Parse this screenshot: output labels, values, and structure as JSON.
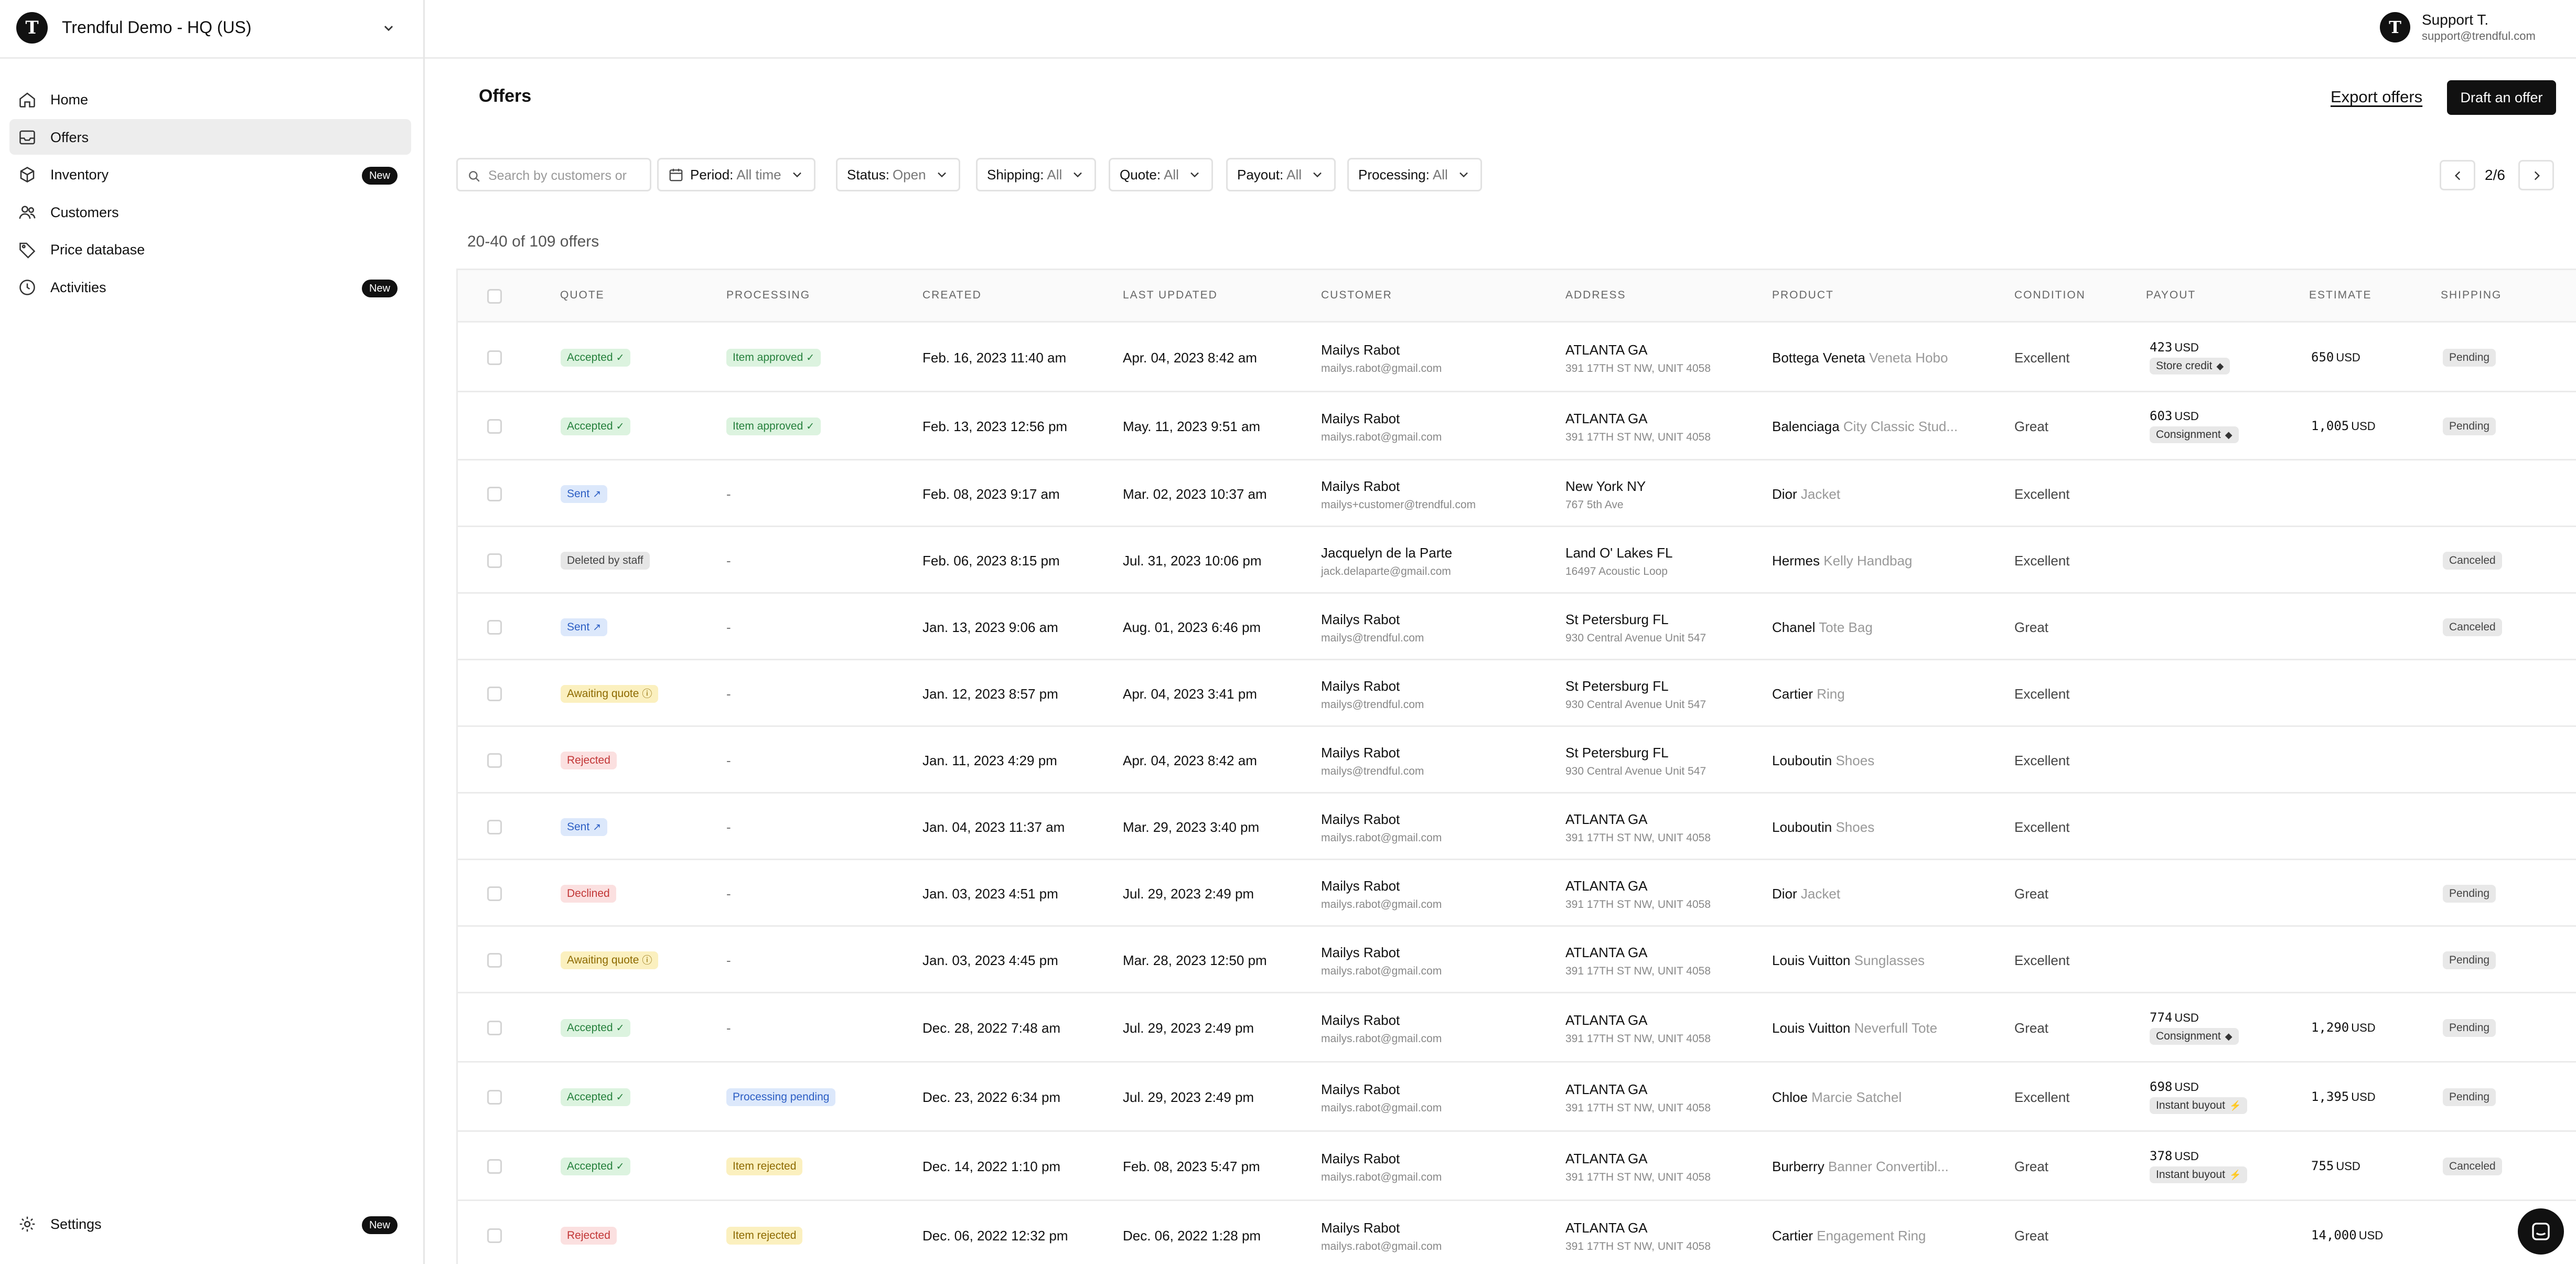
{
  "org": {
    "logo_letter": "T",
    "name": "Trendful Demo - HQ (US)"
  },
  "user": {
    "avatar_letter": "T",
    "name": "Support T.",
    "email": "support@trendful.com"
  },
  "sidebar": {
    "items": [
      {
        "label": "Home",
        "icon": "home-icon"
      },
      {
        "label": "Offers",
        "icon": "inbox-icon"
      },
      {
        "label": "Inventory",
        "icon": "box-icon",
        "badge": "New"
      },
      {
        "label": "Customers",
        "icon": "users-icon"
      },
      {
        "label": "Price database",
        "icon": "tag-icon"
      },
      {
        "label": "Activities",
        "icon": "clock-icon",
        "badge": "New"
      }
    ],
    "settings": {
      "label": "Settings",
      "icon": "gear-icon",
      "badge": "New"
    }
  },
  "page": {
    "title": "Offers",
    "export_label": "Export offers",
    "draft_label": "Draft an offer"
  },
  "search": {
    "placeholder": "Search by customers or"
  },
  "filters": {
    "period": {
      "label": "Period:",
      "value": "All time"
    },
    "status": {
      "label": "Status:",
      "value": "Open"
    },
    "shipping": {
      "label": "Shipping:",
      "value": "All"
    },
    "quote": {
      "label": "Quote:",
      "value": "All"
    },
    "payout": {
      "label": "Payout:",
      "value": "All"
    },
    "processing": {
      "label": "Processing:",
      "value": "All"
    }
  },
  "pager": {
    "text": "2/6"
  },
  "count_text": "20-40 of 109 offers",
  "table": {
    "headers": {
      "quote": "QUOTE",
      "processing": "PROCESSING",
      "created": "CREATED",
      "updated": "LAST UPDATED",
      "customer": "CUSTOMER",
      "address": "ADDRESS",
      "product": "PRODUCT",
      "condition": "CONDITION",
      "payout": "PAYOUT",
      "estimate": "ESTIMATE",
      "shipping": "SHIPPING"
    },
    "rows": [
      {
        "quote": {
          "label": "Accepted",
          "kind": "accepted"
        },
        "processing": {
          "label": "Item approved",
          "kind": "approved"
        },
        "created": "Feb. 16, 2023 11:40 am",
        "updated": "Apr. 04, 2023 8:42 am",
        "customer_name": "Mailys Rabot",
        "customer_email": "mailys.rabot@gmail.com",
        "city": "ATLANTA GA",
        "street": "391 17TH ST NW, UNIT 4058",
        "brand": "Bottega Veneta",
        "model": "Veneta Hobo",
        "condition": "Excellent",
        "payout_amount": "423",
        "payout_currency": "USD",
        "payout_type": "Store credit",
        "payout_icon": "tag-icon",
        "estimate_amount": "650",
        "estimate_currency": "USD",
        "shipping": "Pending"
      },
      {
        "quote": {
          "label": "Accepted",
          "kind": "accepted"
        },
        "processing": {
          "label": "Item approved",
          "kind": "approved"
        },
        "created": "Feb. 13, 2023 12:56 pm",
        "updated": "May. 11, 2023 9:51 am",
        "customer_name": "Mailys Rabot",
        "customer_email": "mailys.rabot@gmail.com",
        "city": "ATLANTA GA",
        "street": "391 17TH ST NW, UNIT 4058",
        "brand": "Balenciaga",
        "model": "City Classic Stud...",
        "condition": "Great",
        "payout_amount": "603",
        "payout_currency": "USD",
        "payout_type": "Consignment",
        "payout_icon": "tag-icon",
        "estimate_amount": "1,005",
        "estimate_currency": "USD",
        "shipping": "Pending"
      },
      {
        "quote": {
          "label": "Sent",
          "kind": "sent"
        },
        "processing": null,
        "created": "Feb. 08, 2023 9:17 am",
        "updated": "Mar. 02, 2023 10:37 am",
        "customer_name": "Mailys Rabot",
        "customer_email": "mailys+customer@trendful.com",
        "city": "New York NY",
        "street": "767 5th Ave",
        "brand": "Dior",
        "model": "Jacket",
        "condition": "Excellent",
        "shipping": null
      },
      {
        "quote": {
          "label": "Deleted by staff",
          "kind": "deleted"
        },
        "processing": null,
        "created": "Feb. 06, 2023 8:15 pm",
        "updated": "Jul. 31, 2023 10:06 pm",
        "customer_name": "Jacquelyn de la Parte",
        "customer_email": "jack.delaparte@gmail.com",
        "city": "Land O' Lakes FL",
        "street": "16497 Acoustic Loop",
        "brand": "Hermes",
        "model": "Kelly Handbag",
        "condition": "Excellent",
        "shipping": "Canceled"
      },
      {
        "quote": {
          "label": "Sent",
          "kind": "sent"
        },
        "processing": null,
        "created": "Jan. 13, 2023 9:06 am",
        "updated": "Aug. 01, 2023 6:46 pm",
        "customer_name": "Mailys Rabot",
        "customer_email": "mailys@trendful.com",
        "city": "St Petersburg FL",
        "street": "930 Central Avenue Unit 547",
        "brand": "Chanel",
        "model": "Tote Bag",
        "condition": "Great",
        "shipping": "Canceled"
      },
      {
        "quote": {
          "label": "Awaiting quote",
          "kind": "awaiting"
        },
        "processing": null,
        "created": "Jan. 12, 2023 8:57 pm",
        "updated": "Apr. 04, 2023 3:41 pm",
        "customer_name": "Mailys Rabot",
        "customer_email": "mailys@trendful.com",
        "city": "St Petersburg FL",
        "street": "930 Central Avenue Unit 547",
        "brand": "Cartier",
        "model": "Ring",
        "condition": "Excellent",
        "shipping": null
      },
      {
        "quote": {
          "label": "Rejected",
          "kind": "rejected"
        },
        "processing": null,
        "created": "Jan. 11, 2023 4:29 pm",
        "updated": "Apr. 04, 2023 8:42 am",
        "customer_name": "Mailys Rabot",
        "customer_email": "mailys@trendful.com",
        "city": "St Petersburg FL",
        "street": "930 Central Avenue Unit 547",
        "brand": "Louboutin",
        "model": "Shoes",
        "condition": "Excellent",
        "shipping": null
      },
      {
        "quote": {
          "label": "Sent",
          "kind": "sent"
        },
        "processing": null,
        "created": "Jan. 04, 2023 11:37 am",
        "updated": "Mar. 29, 2023 3:40 pm",
        "customer_name": "Mailys Rabot",
        "customer_email": "mailys.rabot@gmail.com",
        "city": "ATLANTA GA",
        "street": "391 17TH ST NW, UNIT 4058",
        "brand": "Louboutin",
        "model": "Shoes",
        "condition": "Excellent",
        "shipping": null
      },
      {
        "quote": {
          "label": "Declined",
          "kind": "declined"
        },
        "processing": null,
        "created": "Jan. 03, 2023 4:51 pm",
        "updated": "Jul. 29, 2023 2:49 pm",
        "customer_name": "Mailys Rabot",
        "customer_email": "mailys.rabot@gmail.com",
        "city": "ATLANTA GA",
        "street": "391 17TH ST NW, UNIT 4058",
        "brand": "Dior",
        "model": "Jacket",
        "condition": "Great",
        "shipping": "Pending"
      },
      {
        "quote": {
          "label": "Awaiting quote",
          "kind": "awaiting"
        },
        "processing": null,
        "created": "Jan. 03, 2023 4:45 pm",
        "updated": "Mar. 28, 2023 12:50 pm",
        "customer_name": "Mailys Rabot",
        "customer_email": "mailys.rabot@gmail.com",
        "city": "ATLANTA GA",
        "street": "391 17TH ST NW, UNIT 4058",
        "brand": "Louis Vuitton",
        "model": "Sunglasses",
        "condition": "Excellent",
        "shipping": "Pending"
      },
      {
        "quote": {
          "label": "Accepted",
          "kind": "accepted"
        },
        "processing": null,
        "created": "Dec. 28, 2022 7:48 am",
        "updated": "Jul. 29, 2023 2:49 pm",
        "customer_name": "Mailys Rabot",
        "customer_email": "mailys.rabot@gmail.com",
        "city": "ATLANTA GA",
        "street": "391 17TH ST NW, UNIT 4058",
        "brand": "Louis Vuitton",
        "model": "Neverfull Tote",
        "condition": "Great",
        "payout_amount": "774",
        "payout_currency": "USD",
        "payout_type": "Consignment",
        "payout_icon": "tag-icon",
        "estimate_amount": "1,290",
        "estimate_currency": "USD",
        "shipping": "Pending"
      },
      {
        "quote": {
          "label": "Accepted",
          "kind": "accepted"
        },
        "processing": {
          "label": "Processing pending",
          "kind": "pending"
        },
        "created": "Dec. 23, 2022 6:34 pm",
        "updated": "Jul. 29, 2023 2:49 pm",
        "customer_name": "Mailys Rabot",
        "customer_email": "mailys.rabot@gmail.com",
        "city": "ATLANTA GA",
        "street": "391 17TH ST NW, UNIT 4058",
        "brand": "Chloe",
        "model": "Marcie Satchel",
        "condition": "Excellent",
        "payout_amount": "698",
        "payout_currency": "USD",
        "payout_type": "Instant buyout",
        "payout_icon": "bolt-icon",
        "estimate_amount": "1,395",
        "estimate_currency": "USD",
        "shipping": "Pending"
      },
      {
        "quote": {
          "label": "Accepted",
          "kind": "accepted"
        },
        "processing": {
          "label": "Item rejected",
          "kind": "rejected"
        },
        "created": "Dec. 14, 2022 1:10 pm",
        "updated": "Feb. 08, 2023 5:47 pm",
        "customer_name": "Mailys Rabot",
        "customer_email": "mailys.rabot@gmail.com",
        "city": "ATLANTA GA",
        "street": "391 17TH ST NW, UNIT 4058",
        "brand": "Burberry",
        "model": "Banner Convertibl...",
        "condition": "Great",
        "payout_amount": "378",
        "payout_currency": "USD",
        "payout_type": "Instant buyout",
        "payout_icon": "bolt-icon",
        "estimate_amount": "755",
        "estimate_currency": "USD",
        "shipping": "Canceled"
      },
      {
        "quote": {
          "label": "Rejected",
          "kind": "rejected"
        },
        "processing": {
          "label": "Item rejected",
          "kind": "rejected"
        },
        "created": "Dec. 06, 2022 12:32 pm",
        "updated": "Dec. 06, 2022 1:28 pm",
        "customer_name": "Mailys Rabot",
        "customer_email": "mailys.rabot@gmail.com",
        "city": "ATLANTA GA",
        "street": "391 17TH ST NW, UNIT 4058",
        "brand": "Cartier",
        "model": "Engagement Ring",
        "condition": "Great",
        "estimate_amount": "14,000",
        "estimate_currency": "USD",
        "shipping": null
      }
    ]
  },
  "empty_dash": "-",
  "colors": {
    "accent": "#111111",
    "active_nav": "#ededed",
    "accepted": "#25803c",
    "sent": "#2c5ec4",
    "rejected": "#c23636",
    "awaiting": "#8e6a00"
  }
}
